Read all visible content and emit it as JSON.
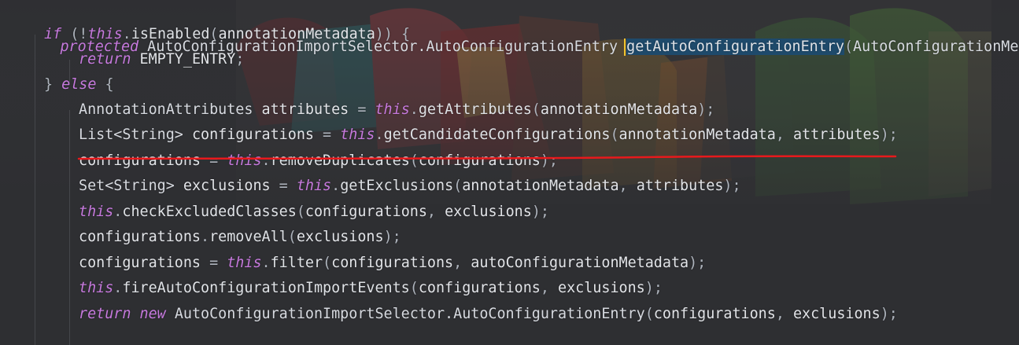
{
  "editor": {
    "method_signature": {
      "modifier": "protected",
      "return_type": "AutoConfigurationImportSelector.AutoConfigurationEntry",
      "method_name": "getAutoConfigurationEntry",
      "open_paren": "(",
      "param_type": "AutoConfigurationMetadata"
    },
    "lines": [
      [
        [
          "kw",
          "if"
        ],
        [
          "pu",
          " (!"
        ],
        [
          "kw",
          "this"
        ],
        [
          "pu",
          "."
        ],
        [
          "me",
          "isEnabled"
        ],
        [
          "pu",
          "("
        ],
        [
          "id",
          "annotationMetadata"
        ],
        [
          "pu",
          ")) {"
        ]
      ],
      [
        [
          "kw",
          "return"
        ],
        [
          "pu",
          " "
        ],
        [
          "co",
          "EMPTY_ENTRY"
        ],
        [
          "pu",
          ";"
        ]
      ],
      [
        [
          "pu",
          "} "
        ],
        [
          "kw",
          "else"
        ],
        [
          "pu",
          " {"
        ]
      ],
      [
        [
          "ty",
          "AnnotationAttributes"
        ],
        [
          "pu",
          " "
        ],
        [
          "id",
          "attributes"
        ],
        [
          "pu",
          " = "
        ],
        [
          "kw",
          "this"
        ],
        [
          "pu",
          "."
        ],
        [
          "me",
          "getAttributes"
        ],
        [
          "pu",
          "("
        ],
        [
          "id",
          "annotationMetadata"
        ],
        [
          "pu",
          ");"
        ]
      ],
      [
        [
          "ty",
          "List<String>"
        ],
        [
          "pu",
          " "
        ],
        [
          "id",
          "configurations"
        ],
        [
          "pu",
          " = "
        ],
        [
          "kw",
          "this"
        ],
        [
          "pu",
          "."
        ],
        [
          "me",
          "getCandidateConfigurations"
        ],
        [
          "pu",
          "("
        ],
        [
          "id",
          "annotationMetadata"
        ],
        [
          "pu",
          ", "
        ],
        [
          "id",
          "attributes"
        ],
        [
          "pu",
          ");"
        ]
      ],
      [
        [
          "id",
          "configurations"
        ],
        [
          "pu",
          " = "
        ],
        [
          "kw",
          "this"
        ],
        [
          "pu",
          "."
        ],
        [
          "me",
          "removeDuplicates"
        ],
        [
          "pu",
          "("
        ],
        [
          "id",
          "configurations"
        ],
        [
          "pu",
          ");"
        ]
      ],
      [
        [
          "ty",
          "Set<String>"
        ],
        [
          "pu",
          " "
        ],
        [
          "id",
          "exclusions"
        ],
        [
          "pu",
          " = "
        ],
        [
          "kw",
          "this"
        ],
        [
          "pu",
          "."
        ],
        [
          "me",
          "getExclusions"
        ],
        [
          "pu",
          "("
        ],
        [
          "id",
          "annotationMetadata"
        ],
        [
          "pu",
          ", "
        ],
        [
          "id",
          "attributes"
        ],
        [
          "pu",
          ");"
        ]
      ],
      [
        [
          "kw",
          "this"
        ],
        [
          "pu",
          "."
        ],
        [
          "me",
          "checkExcludedClasses"
        ],
        [
          "pu",
          "("
        ],
        [
          "id",
          "configurations"
        ],
        [
          "pu",
          ", "
        ],
        [
          "id",
          "exclusions"
        ],
        [
          "pu",
          ");"
        ]
      ],
      [
        [
          "id",
          "configurations"
        ],
        [
          "pu",
          "."
        ],
        [
          "me",
          "removeAll"
        ],
        [
          "pu",
          "("
        ],
        [
          "id",
          "exclusions"
        ],
        [
          "pu",
          ");"
        ]
      ],
      [
        [
          "id",
          "configurations"
        ],
        [
          "pu",
          " = "
        ],
        [
          "kw",
          "this"
        ],
        [
          "pu",
          "."
        ],
        [
          "me",
          "filter"
        ],
        [
          "pu",
          "("
        ],
        [
          "id",
          "configurations"
        ],
        [
          "pu",
          ", "
        ],
        [
          "id",
          "autoConfigurationMetadata"
        ],
        [
          "pu",
          ");"
        ]
      ],
      [
        [
          "kw",
          "this"
        ],
        [
          "pu",
          "."
        ],
        [
          "me",
          "fireAutoConfigurationImportEvents"
        ],
        [
          "pu",
          "("
        ],
        [
          "id",
          "configurations"
        ],
        [
          "pu",
          ", "
        ],
        [
          "id",
          "exclusions"
        ],
        [
          "pu",
          ");"
        ]
      ],
      [
        [
          "kw",
          "return"
        ],
        [
          "pu",
          " "
        ],
        [
          "kw",
          "new"
        ],
        [
          "pu",
          " "
        ],
        [
          "ty",
          "AutoConfigurationImportSelector.AutoConfigurationEntry"
        ],
        [
          "pu",
          "("
        ],
        [
          "id",
          "configurations"
        ],
        [
          "pu",
          ", "
        ],
        [
          "id",
          "exclusions"
        ],
        [
          "pu",
          ");"
        ]
      ]
    ]
  },
  "colors": {
    "keyword": "#c679dd",
    "text": "#e2e4e8",
    "selection": "#1e4a6b",
    "caret": "#f0c430",
    "annotation_underline": "#e8191c"
  }
}
